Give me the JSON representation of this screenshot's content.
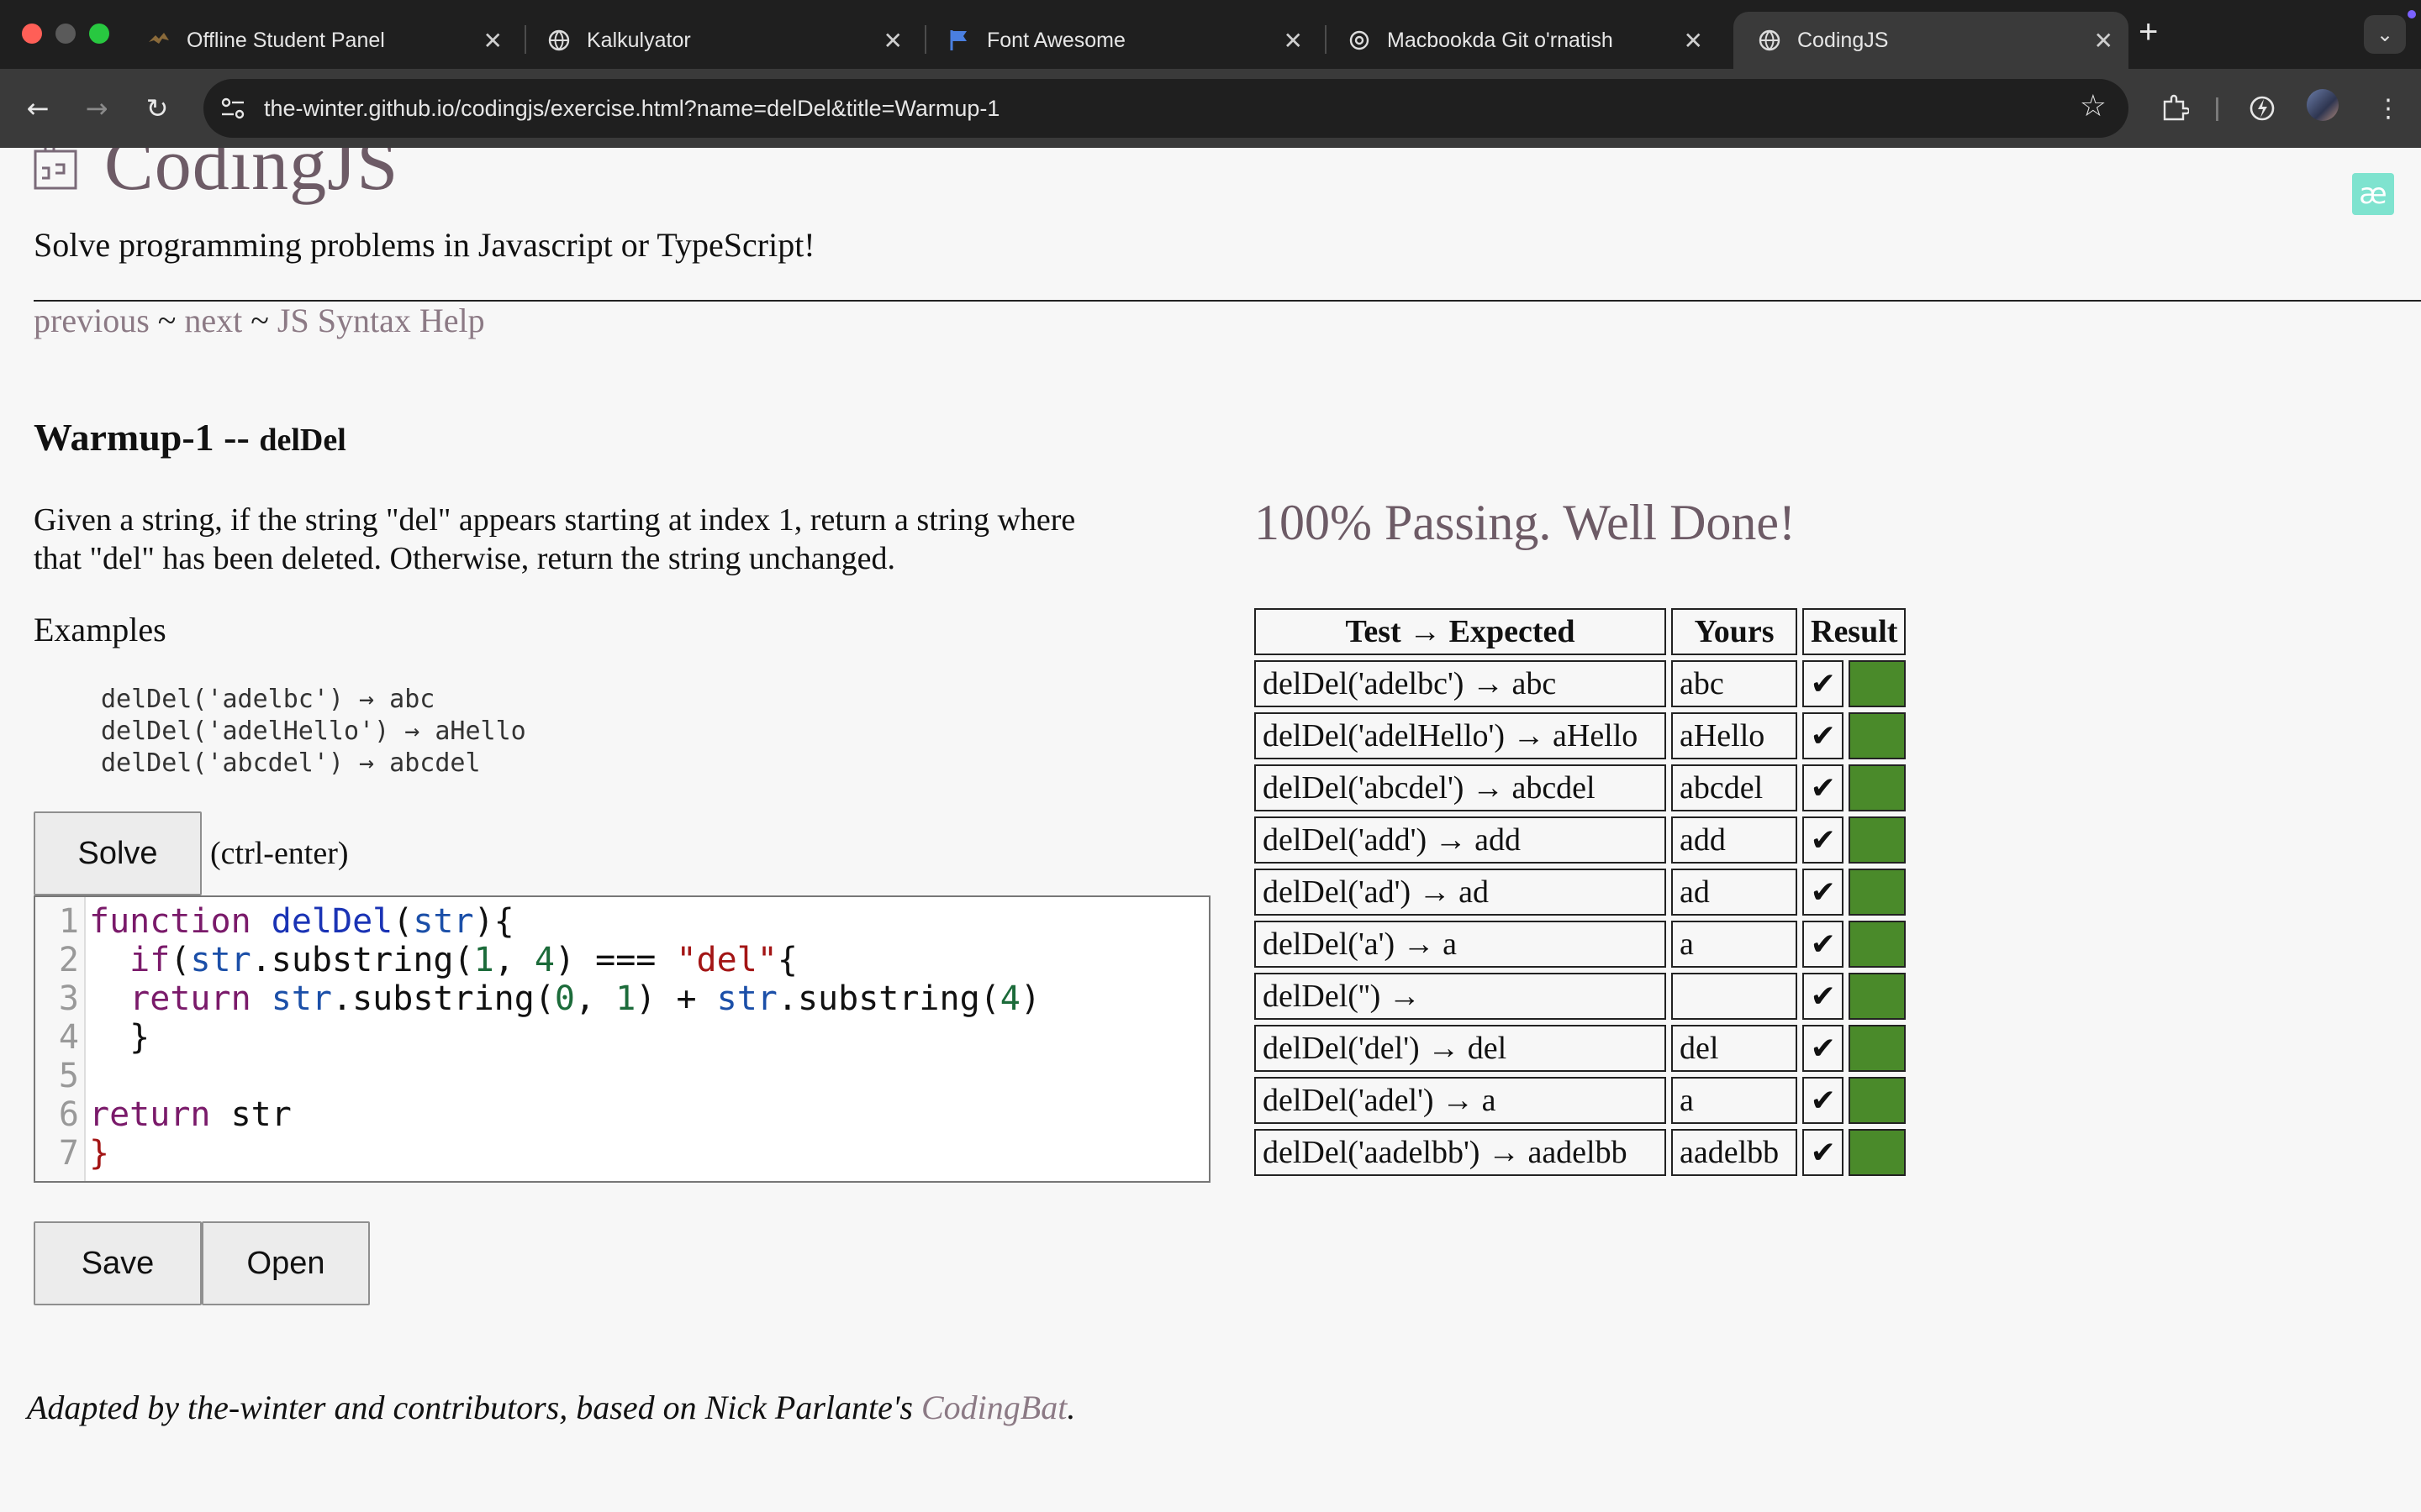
{
  "browser": {
    "tabs": [
      {
        "title": "Offline Student Panel",
        "icon": "bird-icon"
      },
      {
        "title": "Kalkulyator",
        "icon": "globe-icon"
      },
      {
        "title": "Font Awesome",
        "icon": "flag-icon"
      },
      {
        "title": "Macbookda Git o'rnatish",
        "icon": "openai-icon"
      },
      {
        "title": "CodingJS",
        "icon": "globe-icon"
      }
    ],
    "active_tab": 4,
    "url": "the-winter.github.io/codingjs/exercise.html?name=delDel&title=Warmup-1"
  },
  "site": {
    "title": "CodingJS",
    "tagline": "Solve programming problems in Javascript or TypeScript!",
    "nav": {
      "previous": "previous",
      "next": "next",
      "help": "JS Syntax Help",
      "sep": "~"
    }
  },
  "exercise": {
    "title": "Warmup-1 --",
    "name": "delDel",
    "description": "Given a string, if the string \"del\" appears starting at index 1, return a string where that \"del\" has been deleted. Otherwise, return the string unchanged.",
    "examples_label": "Examples",
    "examples": [
      "delDel('adelbc') → abc",
      "delDel('adelHello') → aHello",
      "delDel('abcdel') → abcdel"
    ]
  },
  "buttons": {
    "solve": "Solve",
    "solve_hint": "(ctrl-enter)",
    "save": "Save",
    "open": "Open"
  },
  "code_lines": [
    "function delDel(str){",
    "  if(str.substring(1, 4) === \"del\"{",
    "  return str.substring(0, 1) + str.substring(4)",
    "  }",
    "",
    "return str",
    "}"
  ],
  "results": {
    "status": "100% Passing. Well Done!",
    "headers": [
      "Test → Expected",
      "Yours",
      "Result"
    ],
    "pass_color": "#4a8a2a",
    "rows": [
      {
        "test": "delDel('adelbc') → abc",
        "yours": "abc",
        "mark": "✔"
      },
      {
        "test": "delDel('adelHello') → aHello",
        "yours": "aHello",
        "mark": "✔"
      },
      {
        "test": "delDel('abcdel') → abcdel",
        "yours": "abcdel",
        "mark": "✔"
      },
      {
        "test": "delDel('add') → add",
        "yours": "add",
        "mark": "✔"
      },
      {
        "test": "delDel('ad') → ad",
        "yours": "ad",
        "mark": "✔"
      },
      {
        "test": "delDel('a') → a",
        "yours": "a",
        "mark": "✔"
      },
      {
        "test": "delDel('') →",
        "yours": "",
        "mark": "✔"
      },
      {
        "test": "delDel('del') → del",
        "yours": "del",
        "mark": "✔"
      },
      {
        "test": "delDel('adel') → a",
        "yours": "a",
        "mark": "✔"
      },
      {
        "test": "delDel('aadelbb') → aadelbb",
        "yours": "aadelbb",
        "mark": "✔"
      }
    ]
  },
  "footer": {
    "text": "Adapted by the-winter and contributors, based on Nick Parlante's",
    "link": "CodingBat",
    "end": "."
  }
}
